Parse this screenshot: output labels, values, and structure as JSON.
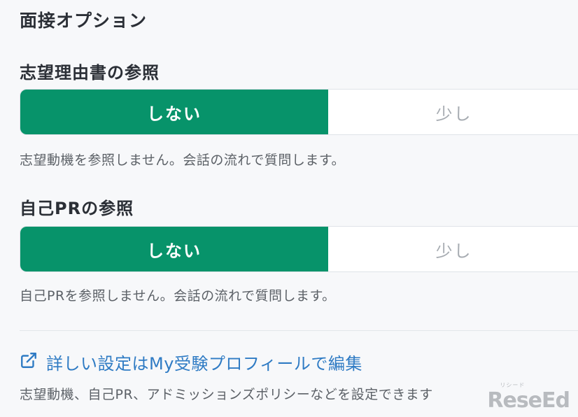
{
  "section": {
    "title": "面接オプション"
  },
  "motivation": {
    "label": "志望理由書の参照",
    "options": [
      "しない",
      "少し"
    ],
    "selected": "しない",
    "hint": "志望動機を参照しません。会話の流れで質問します。"
  },
  "self_pr": {
    "label": "自己PRの参照",
    "options": [
      "しない",
      "少し"
    ],
    "selected": "しない",
    "hint": "自己PRを参照しません。会話の流れで質問します。"
  },
  "profile_link": {
    "icon": "external-link-icon",
    "text": "詳しい設定はMy受験プロフィールで編集",
    "description": "志望動機、自己PR、アドミッションズポリシーなどを設定できます",
    "color": "#2f7bc4"
  },
  "watermark": {
    "text": "ReseEd",
    "subtext": "リシード"
  },
  "colors": {
    "accent": "#07936a"
  }
}
